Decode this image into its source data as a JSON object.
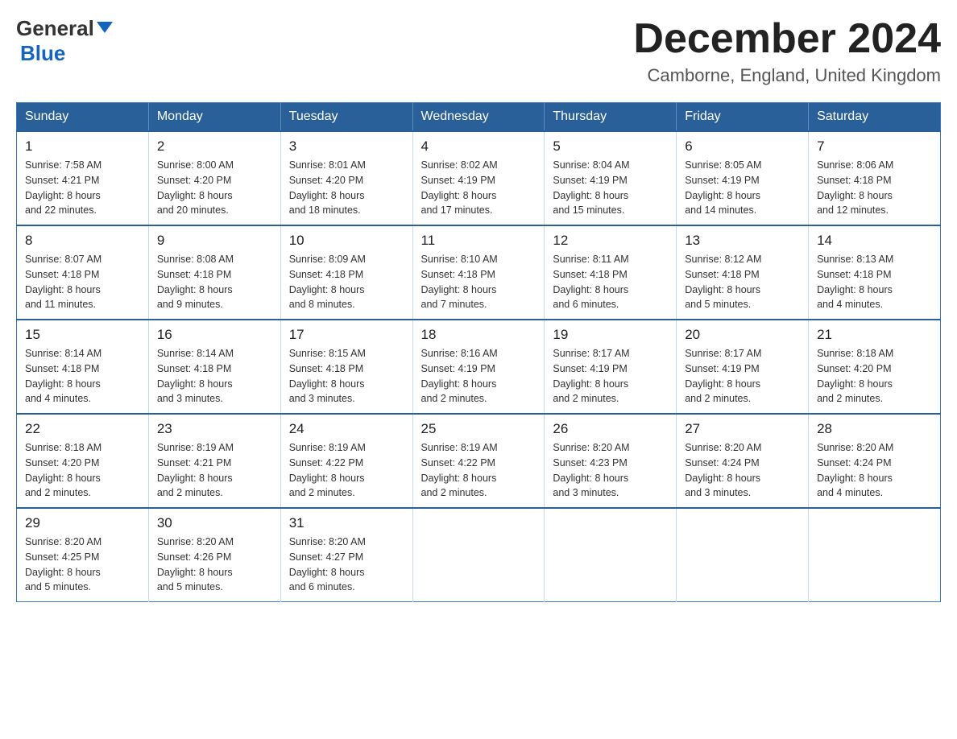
{
  "header": {
    "logo_general": "General",
    "logo_blue": "Blue",
    "month_title": "December 2024",
    "location": "Camborne, England, United Kingdom"
  },
  "calendar": {
    "days_of_week": [
      "Sunday",
      "Monday",
      "Tuesday",
      "Wednesday",
      "Thursday",
      "Friday",
      "Saturday"
    ],
    "weeks": [
      [
        {
          "day": "1",
          "sunrise": "7:58 AM",
          "sunset": "4:21 PM",
          "daylight": "8 hours and 22 minutes."
        },
        {
          "day": "2",
          "sunrise": "8:00 AM",
          "sunset": "4:20 PM",
          "daylight": "8 hours and 20 minutes."
        },
        {
          "day": "3",
          "sunrise": "8:01 AM",
          "sunset": "4:20 PM",
          "daylight": "8 hours and 18 minutes."
        },
        {
          "day": "4",
          "sunrise": "8:02 AM",
          "sunset": "4:19 PM",
          "daylight": "8 hours and 17 minutes."
        },
        {
          "day": "5",
          "sunrise": "8:04 AM",
          "sunset": "4:19 PM",
          "daylight": "8 hours and 15 minutes."
        },
        {
          "day": "6",
          "sunrise": "8:05 AM",
          "sunset": "4:19 PM",
          "daylight": "8 hours and 14 minutes."
        },
        {
          "day": "7",
          "sunrise": "8:06 AM",
          "sunset": "4:18 PM",
          "daylight": "8 hours and 12 minutes."
        }
      ],
      [
        {
          "day": "8",
          "sunrise": "8:07 AM",
          "sunset": "4:18 PM",
          "daylight": "8 hours and 11 minutes."
        },
        {
          "day": "9",
          "sunrise": "8:08 AM",
          "sunset": "4:18 PM",
          "daylight": "8 hours and 9 minutes."
        },
        {
          "day": "10",
          "sunrise": "8:09 AM",
          "sunset": "4:18 PM",
          "daylight": "8 hours and 8 minutes."
        },
        {
          "day": "11",
          "sunrise": "8:10 AM",
          "sunset": "4:18 PM",
          "daylight": "8 hours and 7 minutes."
        },
        {
          "day": "12",
          "sunrise": "8:11 AM",
          "sunset": "4:18 PM",
          "daylight": "8 hours and 6 minutes."
        },
        {
          "day": "13",
          "sunrise": "8:12 AM",
          "sunset": "4:18 PM",
          "daylight": "8 hours and 5 minutes."
        },
        {
          "day": "14",
          "sunrise": "8:13 AM",
          "sunset": "4:18 PM",
          "daylight": "8 hours and 4 minutes."
        }
      ],
      [
        {
          "day": "15",
          "sunrise": "8:14 AM",
          "sunset": "4:18 PM",
          "daylight": "8 hours and 4 minutes."
        },
        {
          "day": "16",
          "sunrise": "8:14 AM",
          "sunset": "4:18 PM",
          "daylight": "8 hours and 3 minutes."
        },
        {
          "day": "17",
          "sunrise": "8:15 AM",
          "sunset": "4:18 PM",
          "daylight": "8 hours and 3 minutes."
        },
        {
          "day": "18",
          "sunrise": "8:16 AM",
          "sunset": "4:19 PM",
          "daylight": "8 hours and 2 minutes."
        },
        {
          "day": "19",
          "sunrise": "8:17 AM",
          "sunset": "4:19 PM",
          "daylight": "8 hours and 2 minutes."
        },
        {
          "day": "20",
          "sunrise": "8:17 AM",
          "sunset": "4:19 PM",
          "daylight": "8 hours and 2 minutes."
        },
        {
          "day": "21",
          "sunrise": "8:18 AM",
          "sunset": "4:20 PM",
          "daylight": "8 hours and 2 minutes."
        }
      ],
      [
        {
          "day": "22",
          "sunrise": "8:18 AM",
          "sunset": "4:20 PM",
          "daylight": "8 hours and 2 minutes."
        },
        {
          "day": "23",
          "sunrise": "8:19 AM",
          "sunset": "4:21 PM",
          "daylight": "8 hours and 2 minutes."
        },
        {
          "day": "24",
          "sunrise": "8:19 AM",
          "sunset": "4:22 PM",
          "daylight": "8 hours and 2 minutes."
        },
        {
          "day": "25",
          "sunrise": "8:19 AM",
          "sunset": "4:22 PM",
          "daylight": "8 hours and 2 minutes."
        },
        {
          "day": "26",
          "sunrise": "8:20 AM",
          "sunset": "4:23 PM",
          "daylight": "8 hours and 3 minutes."
        },
        {
          "day": "27",
          "sunrise": "8:20 AM",
          "sunset": "4:24 PM",
          "daylight": "8 hours and 3 minutes."
        },
        {
          "day": "28",
          "sunrise": "8:20 AM",
          "sunset": "4:24 PM",
          "daylight": "8 hours and 4 minutes."
        }
      ],
      [
        {
          "day": "29",
          "sunrise": "8:20 AM",
          "sunset": "4:25 PM",
          "daylight": "8 hours and 5 minutes."
        },
        {
          "day": "30",
          "sunrise": "8:20 AM",
          "sunset": "4:26 PM",
          "daylight": "8 hours and 5 minutes."
        },
        {
          "day": "31",
          "sunrise": "8:20 AM",
          "sunset": "4:27 PM",
          "daylight": "8 hours and 6 minutes."
        },
        null,
        null,
        null,
        null
      ]
    ],
    "labels": {
      "sunrise": "Sunrise:",
      "sunset": "Sunset:",
      "daylight": "Daylight:"
    }
  }
}
